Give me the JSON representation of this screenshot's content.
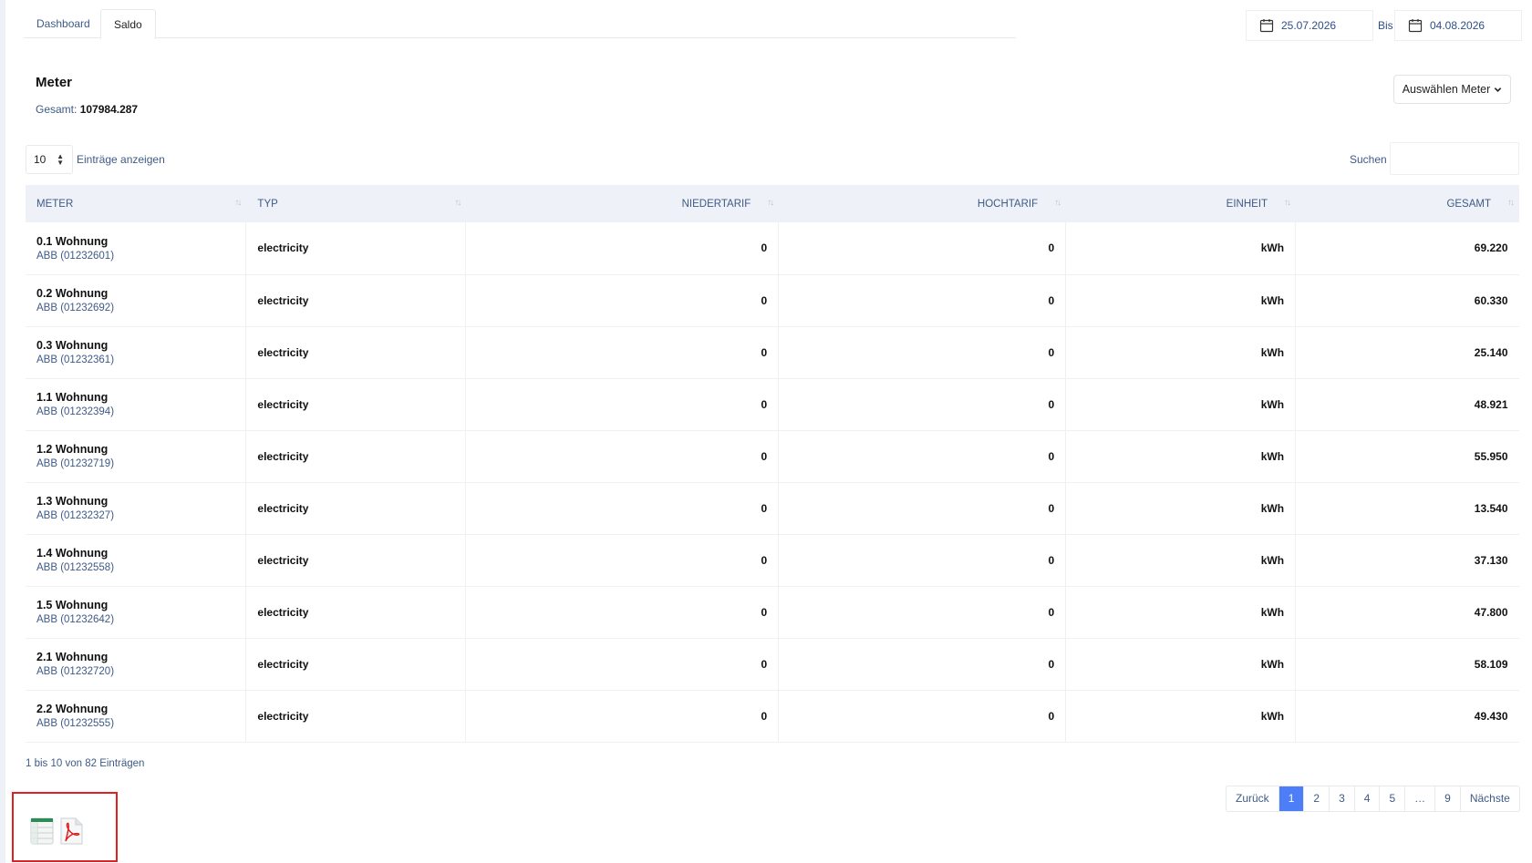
{
  "tabs": [
    {
      "label": "Dashboard"
    },
    {
      "label": "Saldo"
    }
  ],
  "date_range": {
    "from": "25.07.2026",
    "separator": "Bis",
    "to": "04.08.2026"
  },
  "heading": {
    "title": "Meter",
    "total_label": "Gesamt:",
    "total_value": "107984.287"
  },
  "select_meter_button": "Auswählen Meter",
  "table_controls": {
    "length_value": "10",
    "length_label": "Einträge anzeigen",
    "search_label": "Suchen",
    "search_value": ""
  },
  "columns": [
    {
      "label": "METER"
    },
    {
      "label": "TYP"
    },
    {
      "label": "NIEDERTARIF"
    },
    {
      "label": "HOCHTARIF"
    },
    {
      "label": "EINHEIT"
    },
    {
      "label": "GESAMT"
    }
  ],
  "rows": [
    {
      "name": "0.1 Wohnung",
      "device": "ABB (01232601)",
      "type": "electricity",
      "niedertarif": "0",
      "hochtarif": "0",
      "unit": "kWh",
      "total": "69.220"
    },
    {
      "name": "0.2 Wohnung",
      "device": "ABB (01232692)",
      "type": "electricity",
      "niedertarif": "0",
      "hochtarif": "0",
      "unit": "kWh",
      "total": "60.330"
    },
    {
      "name": "0.3 Wohnung",
      "device": "ABB (01232361)",
      "type": "electricity",
      "niedertarif": "0",
      "hochtarif": "0",
      "unit": "kWh",
      "total": "25.140"
    },
    {
      "name": "1.1 Wohnung",
      "device": "ABB (01232394)",
      "type": "electricity",
      "niedertarif": "0",
      "hochtarif": "0",
      "unit": "kWh",
      "total": "48.921"
    },
    {
      "name": "1.2 Wohnung",
      "device": "ABB (01232719)",
      "type": "electricity",
      "niedertarif": "0",
      "hochtarif": "0",
      "unit": "kWh",
      "total": "55.950"
    },
    {
      "name": "1.3 Wohnung",
      "device": "ABB (01232327)",
      "type": "electricity",
      "niedertarif": "0",
      "hochtarif": "0",
      "unit": "kWh",
      "total": "13.540"
    },
    {
      "name": "1.4 Wohnung",
      "device": "ABB (01232558)",
      "type": "electricity",
      "niedertarif": "0",
      "hochtarif": "0",
      "unit": "kWh",
      "total": "37.130"
    },
    {
      "name": "1.5 Wohnung",
      "device": "ABB (01232642)",
      "type": "electricity",
      "niedertarif": "0",
      "hochtarif": "0",
      "unit": "kWh",
      "total": "47.800"
    },
    {
      "name": "2.1 Wohnung",
      "device": "ABB (01232720)",
      "type": "electricity",
      "niedertarif": "0",
      "hochtarif": "0",
      "unit": "kWh",
      "total": "58.109"
    },
    {
      "name": "2.2 Wohnung",
      "device": "ABB (01232555)",
      "type": "electricity",
      "niedertarif": "0",
      "hochtarif": "0",
      "unit": "kWh",
      "total": "49.430"
    }
  ],
  "info_text": "1 bis 10 von 82 Einträgen",
  "pagination": {
    "prev": "Zurück",
    "pages": [
      "1",
      "2",
      "3",
      "4",
      "5",
      "…",
      "9"
    ],
    "active": "1",
    "next": "Nächste"
  },
  "export_icons": [
    "spreadsheet-icon",
    "pdf-icon"
  ],
  "colors": {
    "accent": "#4d7ef7",
    "link_text": "#3e5a87",
    "header_bg": "#eef2f8",
    "highlight_border": "#e02020"
  }
}
